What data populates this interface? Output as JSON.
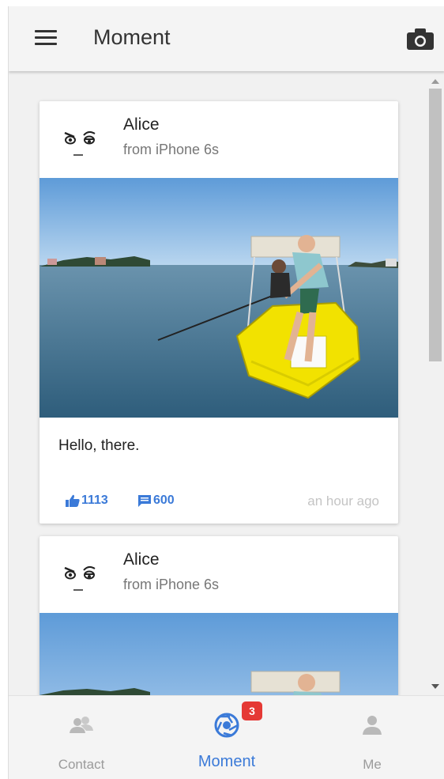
{
  "header": {
    "title": "Moment",
    "menu_icon": "hamburger-menu-icon",
    "camera_icon": "camera-icon"
  },
  "posts": [
    {
      "author": "Alice",
      "source": "from iPhone 6s",
      "avatar_icon": "cartoon-face-avatar",
      "image": "man-fishing-in-yellow-boat-photo",
      "message": "Hello, there.",
      "likes": "1113",
      "comments": "600",
      "time": "an hour ago"
    },
    {
      "author": "Alice",
      "source": "from iPhone 6s",
      "avatar_icon": "cartoon-face-avatar",
      "image": "man-fishing-in-yellow-boat-photo"
    }
  ],
  "nav": {
    "items": [
      {
        "label": "Contact",
        "icon": "contacts-icon",
        "active": false
      },
      {
        "label": "Moment",
        "icon": "aperture-icon",
        "active": true,
        "badge": "3"
      },
      {
        "label": "Me",
        "icon": "person-icon",
        "active": false
      }
    ]
  },
  "colors": {
    "accent": "#3b7ad8",
    "badge": "#e53935",
    "boat": "#f2e200",
    "sky": "#6fa8e0",
    "water": "#3f6e90"
  }
}
